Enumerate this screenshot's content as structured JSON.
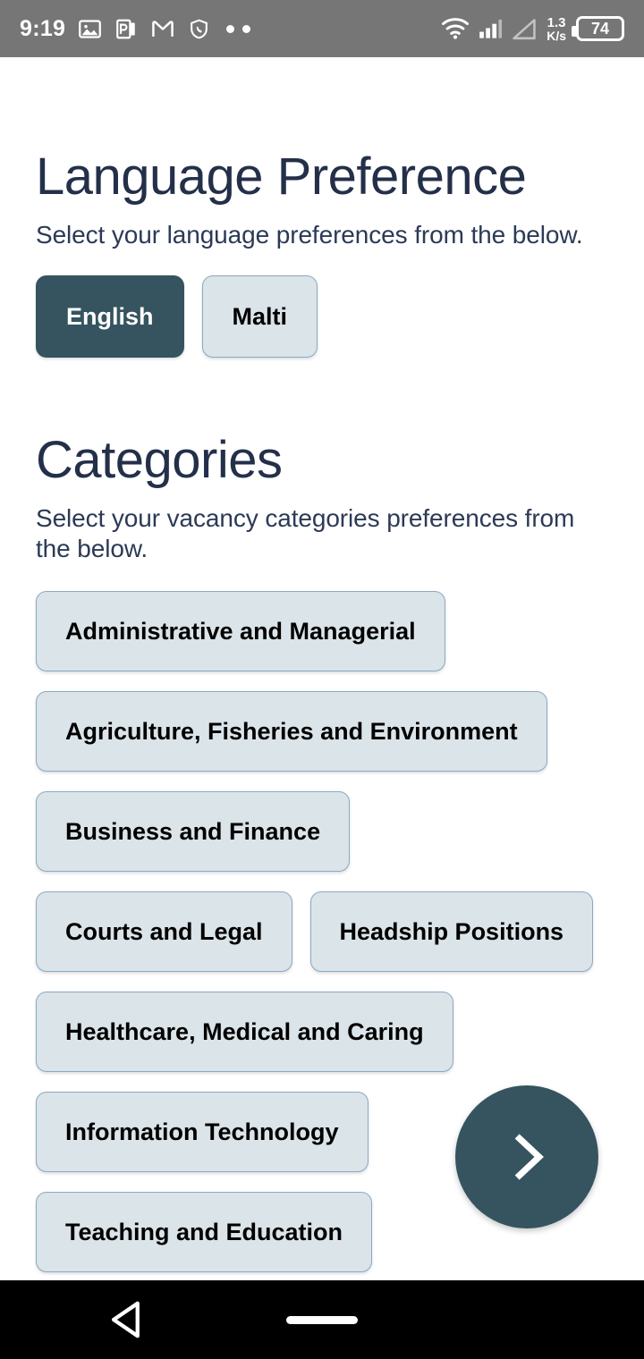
{
  "status_bar": {
    "time": "9:19",
    "left_icons": [
      "gallery-icon",
      "powerpoint-icon",
      "gmail-icon",
      "shield-icon",
      "more-dots-icon"
    ],
    "data_rate_value": "1.3",
    "data_rate_unit": "K/s",
    "battery_level": "74",
    "right_icons": [
      "wifi-icon",
      "signal-bars-icon",
      "signal-triangle-icon"
    ],
    "background_color": "#767676"
  },
  "language_section": {
    "title": "Language Preference",
    "subtitle": "Select your language preferences from the below.",
    "options": [
      {
        "label": "English",
        "selected": true
      },
      {
        "label": "Malti",
        "selected": false
      }
    ]
  },
  "categories_section": {
    "title": "Categories",
    "subtitle": "Select your vacancy categories preferences from the below.",
    "options": [
      {
        "label": "Administrative and Managerial",
        "selected": false
      },
      {
        "label": "Agriculture, Fisheries and Environment",
        "selected": false
      },
      {
        "label": "Business and Finance",
        "selected": false
      },
      {
        "label": "Courts and Legal",
        "selected": false
      },
      {
        "label": "Headship Positions",
        "selected": false
      },
      {
        "label": "Healthcare, Medical and Caring",
        "selected": false
      },
      {
        "label": "Information Technology",
        "selected": false
      },
      {
        "label": "Teaching and Education",
        "selected": false
      }
    ]
  },
  "next_button": {
    "icon": "chevron-right-icon"
  },
  "nav_bar": {
    "back_icon": "back-triangle-icon",
    "home_icon": "home-pill-icon",
    "background_color": "#000000"
  },
  "colors": {
    "accent_dark": "#35545f",
    "chip_background": "#dbe4e8",
    "chip_border": "#8aa9c4",
    "heading_text": "#24304a",
    "body_text": "#2c3a56",
    "page_background": "#ffffff"
  }
}
